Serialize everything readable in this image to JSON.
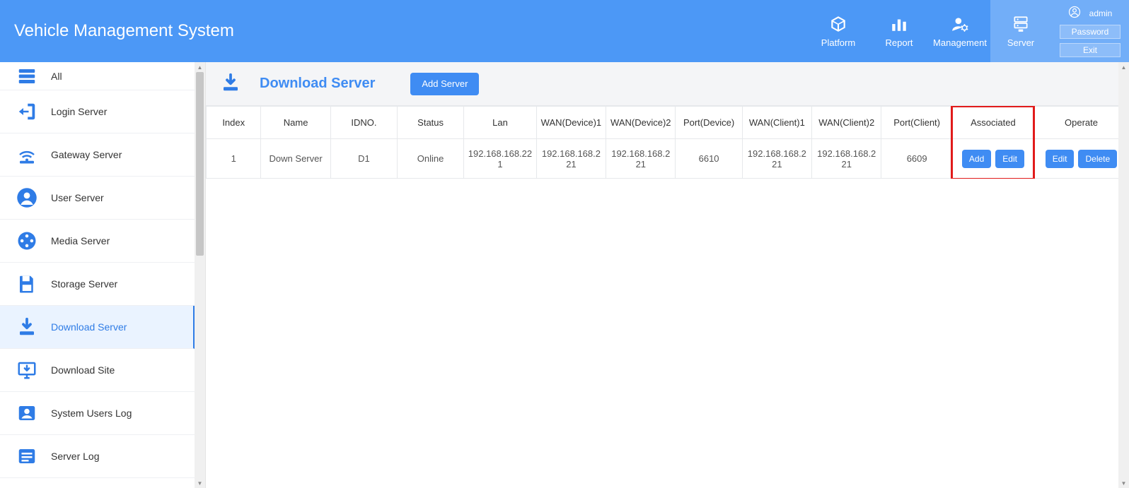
{
  "header": {
    "title": "Vehicle Management System",
    "nav": [
      {
        "key": "platform",
        "label": "Platform"
      },
      {
        "key": "report",
        "label": "Report"
      },
      {
        "key": "management",
        "label": "Management"
      },
      {
        "key": "server",
        "label": "Server",
        "active": true
      }
    ],
    "account": {
      "username": "admin",
      "password_btn": "Password",
      "exit_btn": "Exit"
    }
  },
  "sidebar": {
    "items": [
      {
        "key": "all",
        "label": "All"
      },
      {
        "key": "login",
        "label": "Login Server"
      },
      {
        "key": "gateway",
        "label": "Gateway Server"
      },
      {
        "key": "user",
        "label": "User Server"
      },
      {
        "key": "media",
        "label": "Media Server"
      },
      {
        "key": "storage",
        "label": "Storage Server"
      },
      {
        "key": "download",
        "label": "Download Server",
        "active": true
      },
      {
        "key": "dlsite",
        "label": "Download Site"
      },
      {
        "key": "syslog",
        "label": "System Users Log"
      },
      {
        "key": "serverlog",
        "label": "Server Log"
      }
    ]
  },
  "page": {
    "title": "Download Server",
    "add_btn": "Add Server"
  },
  "table": {
    "columns": {
      "index": "Index",
      "name": "Name",
      "idno": "IDNO.",
      "status": "Status",
      "lan": "Lan",
      "wan_dev1": "WAN(Device)1",
      "wan_dev2": "WAN(Device)2",
      "port_dev": "Port(Device)",
      "wan_cli1": "WAN(Client)1",
      "wan_cli2": "WAN(Client)2",
      "port_cli": "Port(Client)",
      "associated": "Associated",
      "operate": "Operate"
    },
    "rows": [
      {
        "index": "1",
        "name": "Down Server",
        "idno": "D1",
        "status": "Online",
        "lan": "192.168.168.221",
        "wan_dev1": "192.168.168.221",
        "wan_dev2": "192.168.168.221",
        "port_dev": "6610",
        "wan_cli1": "192.168.168.221",
        "wan_cli2": "192.168.168.221",
        "port_cli": "6609"
      }
    ],
    "buttons": {
      "assoc_add": "Add",
      "assoc_edit": "Edit",
      "op_edit": "Edit",
      "op_delete": "Delete"
    }
  }
}
